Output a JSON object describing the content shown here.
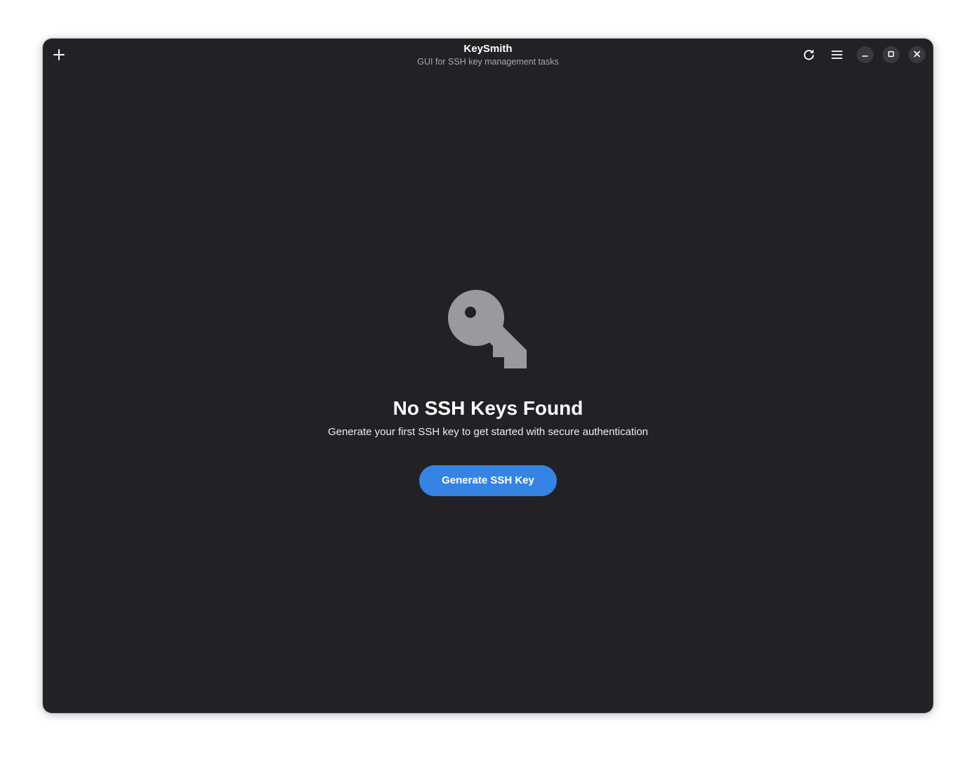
{
  "window": {
    "title": "KeySmith",
    "subtitle": "GUI for SSH key management tasks"
  },
  "headerbar": {
    "left_icons": [
      "plus-icon"
    ],
    "right_icons": [
      "refresh-icon",
      "hamburger-menu-icon"
    ],
    "window_controls": [
      "minimize-icon",
      "maximize-icon",
      "close-icon"
    ]
  },
  "empty_state": {
    "icon": "key-icon",
    "title": "No SSH Keys Found",
    "description": "Generate your first SSH key to get started with secure authentication",
    "button_label": "Generate SSH Key"
  },
  "colors": {
    "window_background": "#222226",
    "accent": "#3584e4",
    "icon_gray": "#9a9a9e"
  }
}
